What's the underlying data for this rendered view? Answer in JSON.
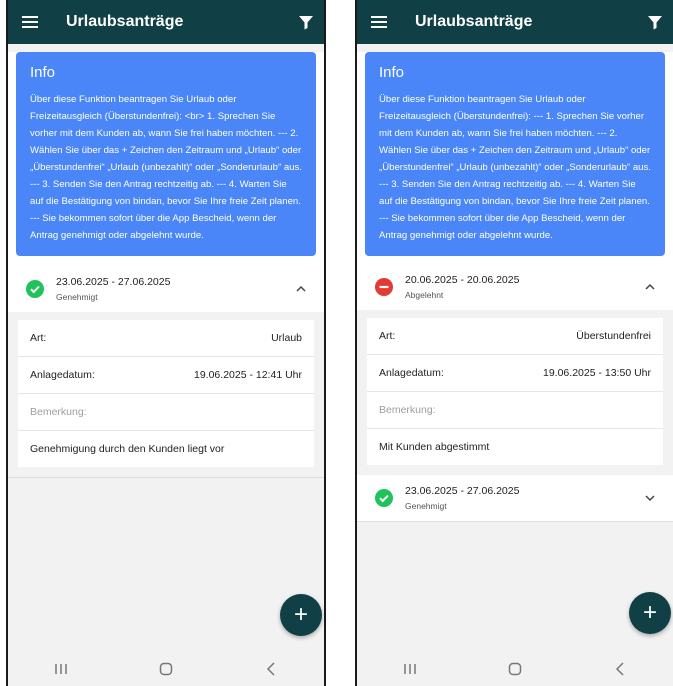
{
  "colors": {
    "topbar": "#103f45",
    "info_bg": "#4a86f7",
    "approved": "#22c25b",
    "rejected": "#e53935"
  },
  "screens": [
    {
      "app_title": "Urlaubsanträge",
      "info": {
        "heading": "Info",
        "text": "Über diese Funktion beantragen Sie Urlaub oder Freizeitausgleich (Überstundenfrei): <br> 1. Sprechen Sie vorher mit dem Kunden ab, wann Sie frei haben möchten. --- 2. Wählen Sie über das + Zeichen den Zeitraum und „Urlaub“ oder „Überstundenfrei“ „Urlaub (unbezahlt)“ oder „Sonderurlaub“ aus. --- 3. Senden Sie den Antrag rechtzeitig ab. --- 4. Warten Sie auf die Bestätigung von bindan, bevor Sie Ihre freie Zeit planen. --- Sie bekommen sofort über die App Bescheid, wenn der Antrag genehmigt oder abgelehnt wurde."
      },
      "requests": [
        {
          "date_range": "23.06.2025 - 27.06.2025",
          "status": "Genehmigt",
          "art_label": "Art:",
          "art_value": "Urlaub",
          "created_label": "Anlagedatum:",
          "created_value": "19.06.2025 - 12:41 Uhr",
          "remark_label": "Bemerkung:",
          "remark_value": "Genehmigung durch den Kunden liegt vor"
        }
      ],
      "fab": "+"
    },
    {
      "app_title": "Urlaubsanträge",
      "info": {
        "heading": "Info",
        "text": "Über diese Funktion beantragen Sie Urlaub oder Freizeitausgleich (Überstundenfrei): --- 1. Sprechen Sie vorher mit dem Kunden ab, wann Sie frei haben möchten. --- 2. Wählen Sie über das + Zeichen den Zeitraum und „Urlaub“ oder „Überstundenfrei“ „Urlaub (unbezahlt)“ oder „Sonderurlaub“ aus. --- 3. Senden Sie den Antrag rechtzeitig ab. --- 4. Warten Sie auf die Bestätigung von bindan, bevor Sie Ihre freie Zeit planen. --- Sie bekommen sofort über die App Bescheid, wenn der Antrag genehmigt oder abgelehnt wurde."
      },
      "requests": [
        {
          "date_range": "20.06.2025 - 20.06.2025",
          "status": "Abgelehnt",
          "art_label": "Art:",
          "art_value": "Überstundenfrei",
          "created_label": "Anlagedatum:",
          "created_value": "19.06.2025 - 13:50 Uhr",
          "remark_label": "Bemerkung:",
          "remark_value": "Mit Kunden abgestimmt"
        },
        {
          "date_range": "23.06.2025 - 27.06.2025",
          "status": "Genehmigt"
        }
      ],
      "fab": "+"
    }
  ],
  "navbar": {
    "recents_icon": "recents-icon",
    "home_icon": "home-icon",
    "back_icon": "back-icon"
  }
}
